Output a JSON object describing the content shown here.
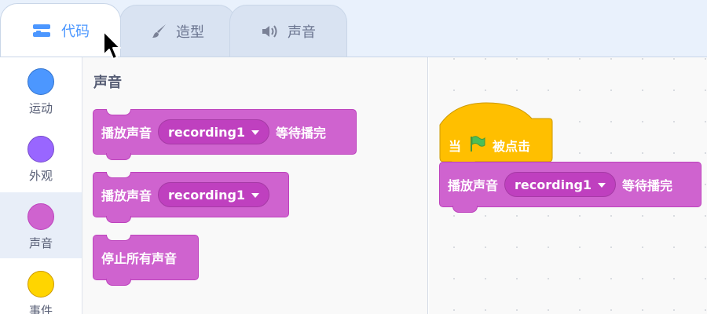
{
  "tabs": {
    "code": "代码",
    "costumes": "造型",
    "sounds": "声音"
  },
  "categories": [
    {
      "label": "运动",
      "color": "#4c97ff",
      "border": "#3373cc"
    },
    {
      "label": "外观",
      "color": "#9966ff",
      "border": "#774dcb"
    },
    {
      "label": "声音",
      "color": "#cf63cf",
      "border": "#bd42bd"
    },
    {
      "label": "事件",
      "color": "#ffd500",
      "border": "#cc9900"
    }
  ],
  "palette": {
    "heading": "声音",
    "play_until_done": {
      "text": "播放声音",
      "sound": "recording1",
      "suffix": "等待播完"
    },
    "start_sound": {
      "text": "播放声音",
      "sound": "recording1"
    },
    "stop_all": {
      "text": "停止所有声音"
    }
  },
  "script": {
    "hat": {
      "prefix": "当",
      "suffix": "被点击"
    },
    "play": {
      "text": "播放声音",
      "sound": "recording1",
      "suffix": "等待播完"
    }
  },
  "colors": {
    "sound": "#cf63cf",
    "events": "#ffbf00",
    "accent": "#4c97ff"
  },
  "icons": [
    "code-icon",
    "brush-icon",
    "speaker-icon",
    "green-flag-icon",
    "dropdown-caret-icon",
    "mouse-cursor-icon"
  ]
}
